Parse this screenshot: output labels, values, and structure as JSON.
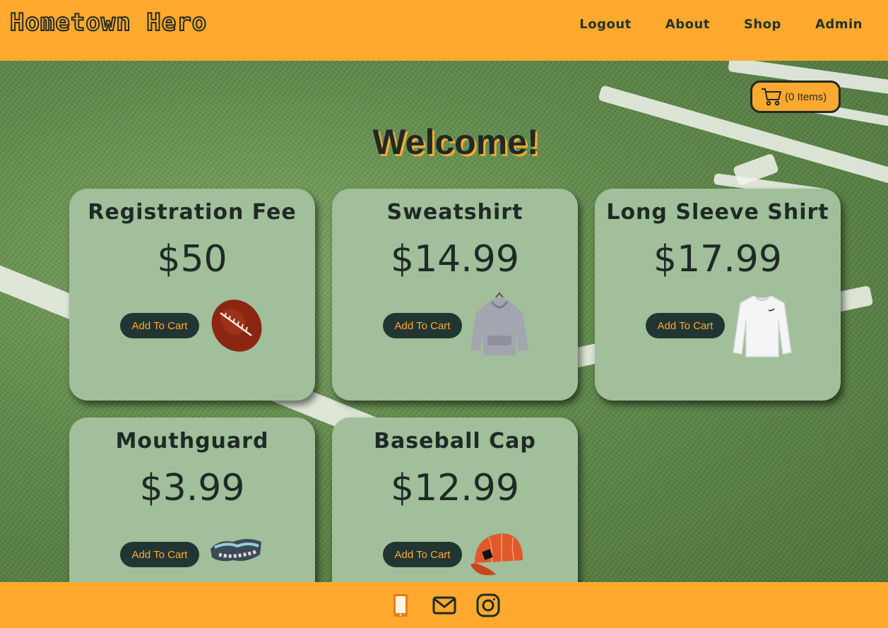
{
  "brand": "Hometown Hero",
  "nav": [
    {
      "label": "Logout"
    },
    {
      "label": "About"
    },
    {
      "label": "Shop"
    },
    {
      "label": "Admin"
    }
  ],
  "cart": {
    "label": "(0 Items)",
    "icon": "shopping-cart-icon"
  },
  "welcome": "Welcome!",
  "products": [
    {
      "name": "Registration Fee",
      "price": "$50",
      "button": "Add To Cart",
      "image": "football-image"
    },
    {
      "name": "Sweatshirt",
      "price": "$14.99",
      "button": "Add To Cart",
      "image": "sweatshirt-image"
    },
    {
      "name": "Long Sleeve Shirt",
      "price": "$17.99",
      "button": "Add To Cart",
      "image": "long-sleeve-shirt-image"
    },
    {
      "name": "Mouthguard",
      "price": "$3.99",
      "button": "Add To Cart",
      "image": "mouthguard-image"
    },
    {
      "name": "Baseball Cap",
      "price": "$12.99",
      "button": "Add To Cart",
      "image": "baseball-cap-image"
    }
  ],
  "footer": {
    "icons": [
      "phone-icon",
      "email-icon",
      "instagram-icon"
    ]
  },
  "colors": {
    "accent": "#ffa92e",
    "dark": "#1e2a26",
    "card": "#a0bf9a",
    "button": "#213532"
  }
}
